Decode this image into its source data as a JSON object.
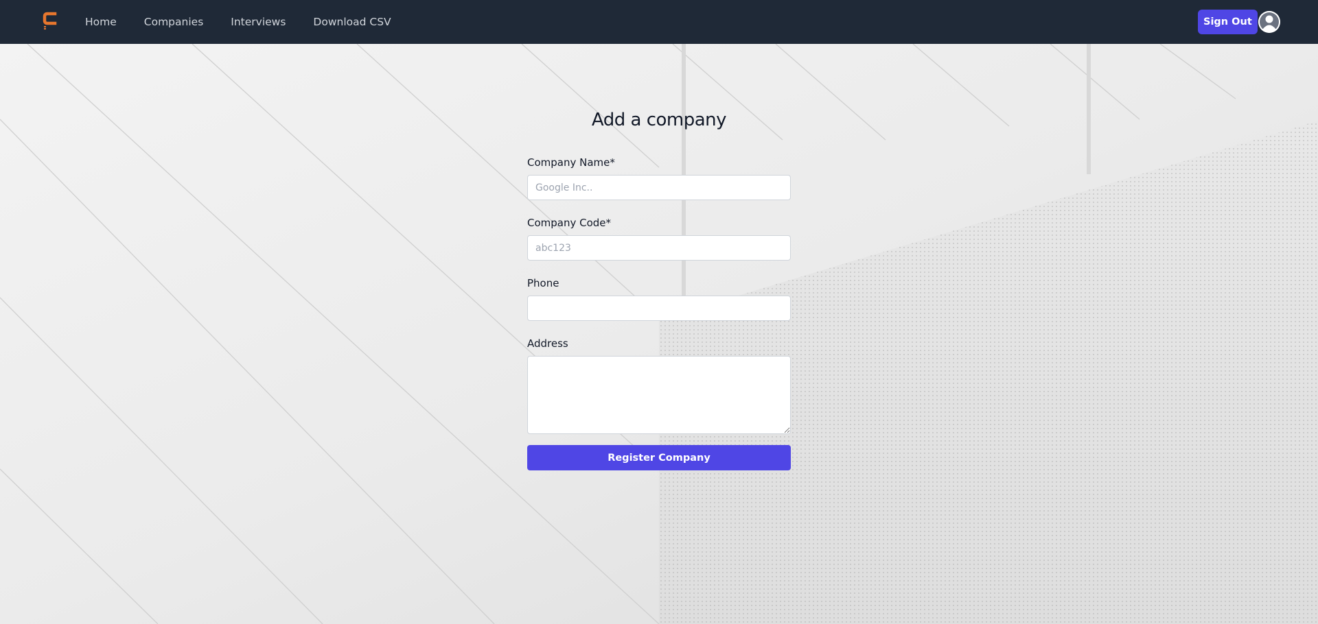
{
  "nav": {
    "logo_icon": "c-brand-logo-icon",
    "links": [
      {
        "label": "Home"
      },
      {
        "label": "Companies"
      },
      {
        "label": "Interviews"
      },
      {
        "label": "Download CSV"
      }
    ],
    "signout_label": "Sign Out",
    "avatar_icon": "user-avatar-icon"
  },
  "form": {
    "title": "Add a company",
    "fields": [
      {
        "label": "Company Name*",
        "placeholder": "Google Inc..",
        "value": ""
      },
      {
        "label": "Company Code*",
        "placeholder": "abc123",
        "value": ""
      },
      {
        "label": "Phone",
        "placeholder": "",
        "value": ""
      },
      {
        "label": "Address",
        "placeholder": "",
        "value": ""
      }
    ],
    "submit_label": "Register Company"
  },
  "colors": {
    "nav_bg": "#1f2937",
    "accent": "#4f46e5",
    "logo": "#e8772e",
    "page_bg": "#ececec"
  }
}
